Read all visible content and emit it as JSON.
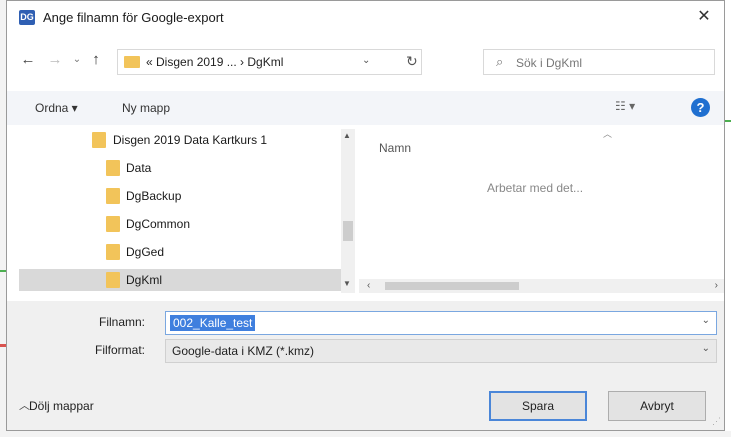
{
  "window": {
    "app_icon": "DG",
    "title": "Ange filnamn för Google-export",
    "close_label": "✕"
  },
  "nav": {
    "back_icon": "←",
    "forward_icon": "→",
    "recent_icon": "⌄",
    "up_icon": "↑",
    "address_path": "« Disgen 2019 ...  ›  DgKml",
    "address_dropdown": "⌄",
    "refresh_icon": "↻",
    "search_placeholder": "Sök i DgKml"
  },
  "toolbar": {
    "organize_label": "Ordna ▾",
    "new_folder_label": "Ny mapp",
    "view_icon": "☷ ▾",
    "help_label": "?"
  },
  "tree": {
    "items": [
      {
        "label": "Disgen 2019 Data Kartkurs 1"
      },
      {
        "label": "Data"
      },
      {
        "label": "DgBackup"
      },
      {
        "label": "DgCommon"
      },
      {
        "label": "DgGed"
      },
      {
        "label": "DgKml"
      }
    ],
    "selected_index": 5
  },
  "filepane": {
    "column_name": "Namn",
    "working_text": "Arbetar med det..."
  },
  "fields": {
    "filename_label": "Filnamn:",
    "filename_value": "002_Kalle_test",
    "format_label": "Filformat:",
    "format_value": "Google-data i KMZ (*.kmz)"
  },
  "footer": {
    "hide_folders_label": "Dölj mappar",
    "save_label": "Spara",
    "cancel_label": "Avbryt"
  }
}
